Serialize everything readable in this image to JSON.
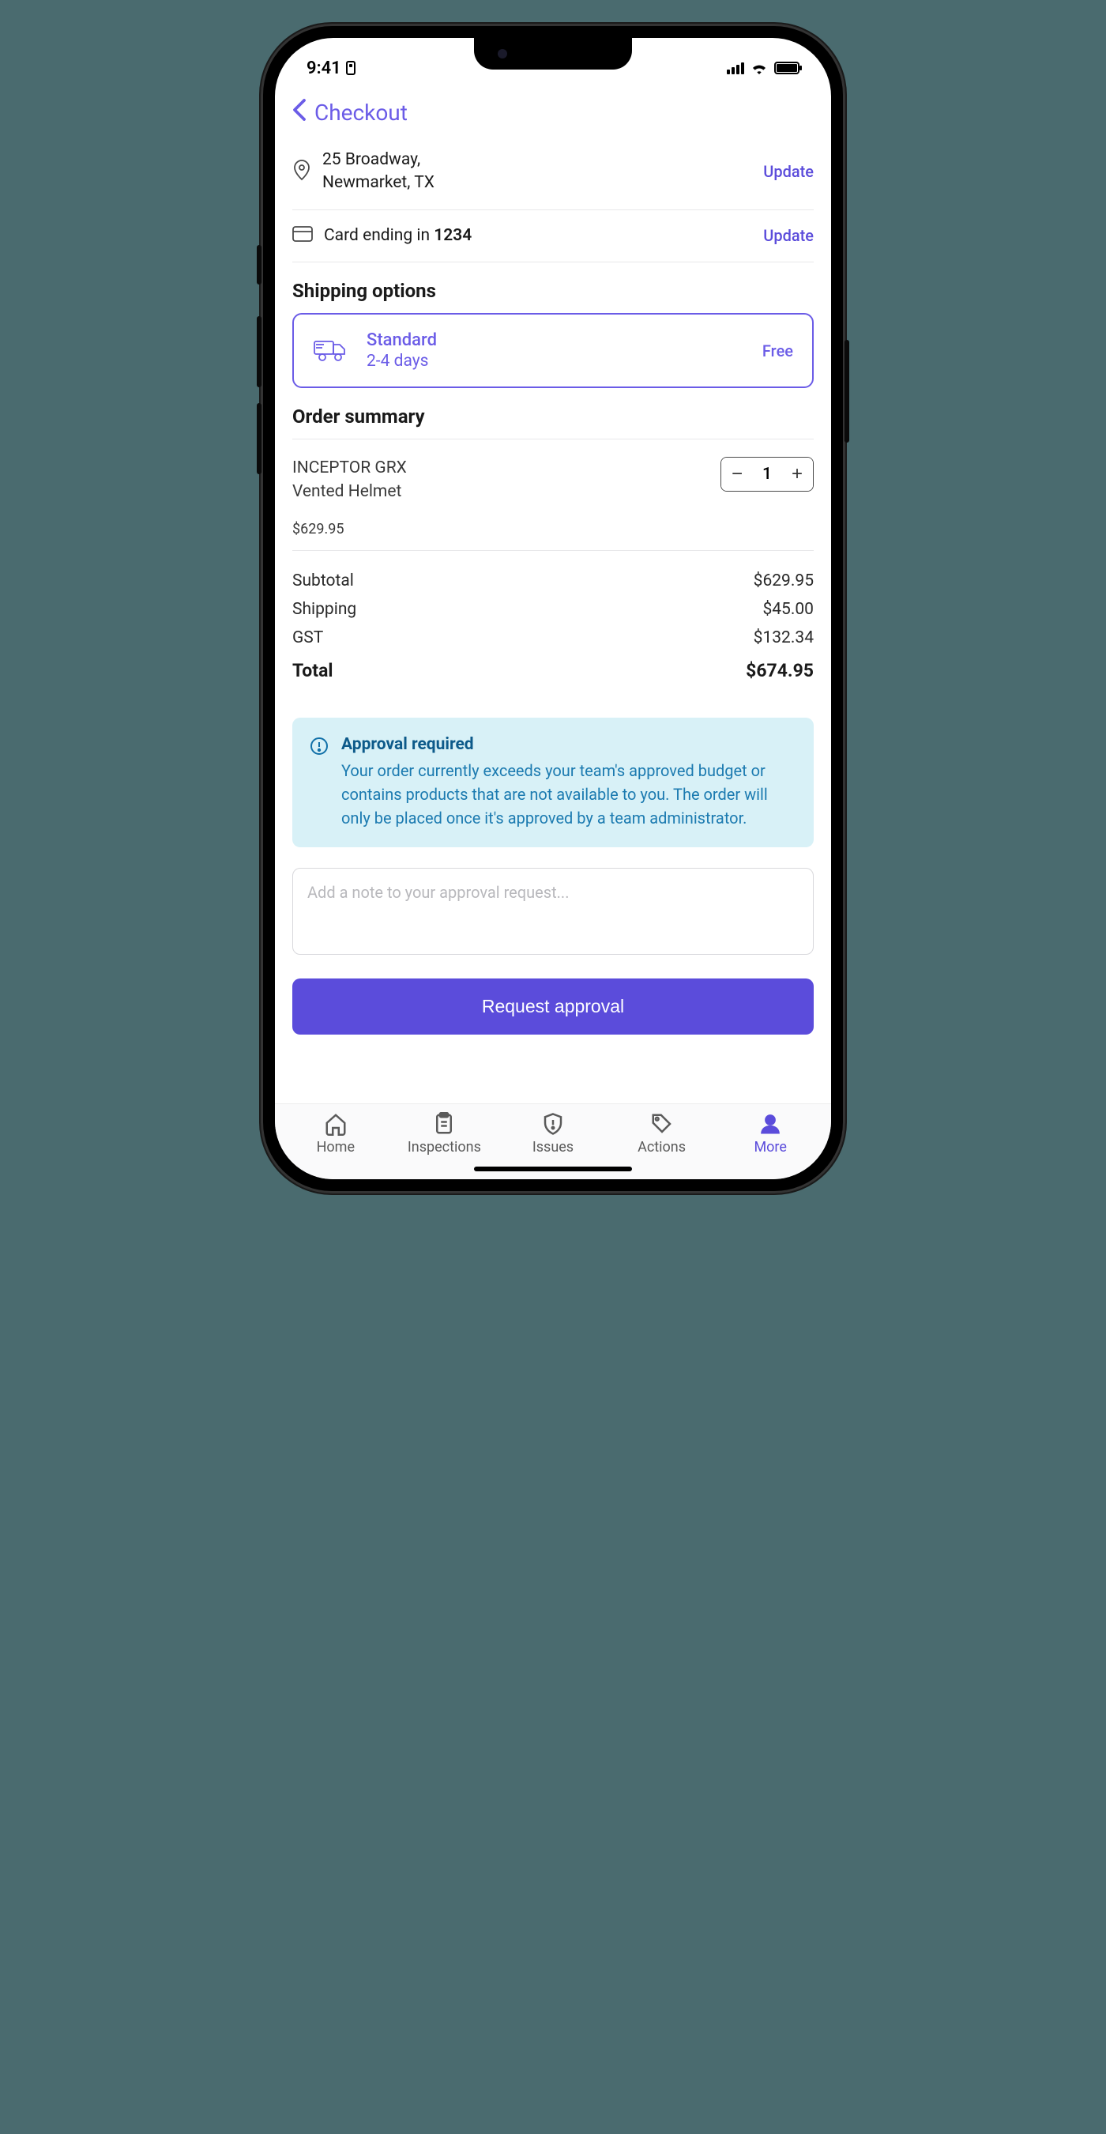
{
  "statusBar": {
    "time": "9:41"
  },
  "nav": {
    "title": "Checkout"
  },
  "address": {
    "line1": "25 Broadway,",
    "line2": "Newmarket, TX",
    "action": "Update"
  },
  "payment": {
    "prefix": "Card ending in ",
    "last4": "1234",
    "action": "Update"
  },
  "shipping": {
    "heading": "Shipping options",
    "option": {
      "name": "Standard",
      "eta": "2-4 days",
      "price": "Free"
    }
  },
  "summary": {
    "heading": "Order summary",
    "item": {
      "line1": "INCEPTOR GRX",
      "line2": "Vented Helmet",
      "qty": "1",
      "price": "$629.95"
    },
    "lines": {
      "subtotal_label": "Subtotal",
      "subtotal_value": "$629.95",
      "shipping_label": "Shipping",
      "shipping_value": "$45.00",
      "gst_label": "GST",
      "gst_value": "$132.34",
      "total_label": "Total",
      "total_value": "$674.95"
    }
  },
  "alert": {
    "title": "Approval required",
    "body": "Your order currently exceeds your team's approved budget or contains products that are not available to you. The order will only be placed once it's approved by a team administrator."
  },
  "note": {
    "placeholder": "Add a note to your approval request..."
  },
  "cta": {
    "label": "Request approval"
  },
  "tabs": {
    "home": "Home",
    "inspections": "Inspections",
    "issues": "Issues",
    "actions": "Actions",
    "more": "More"
  }
}
